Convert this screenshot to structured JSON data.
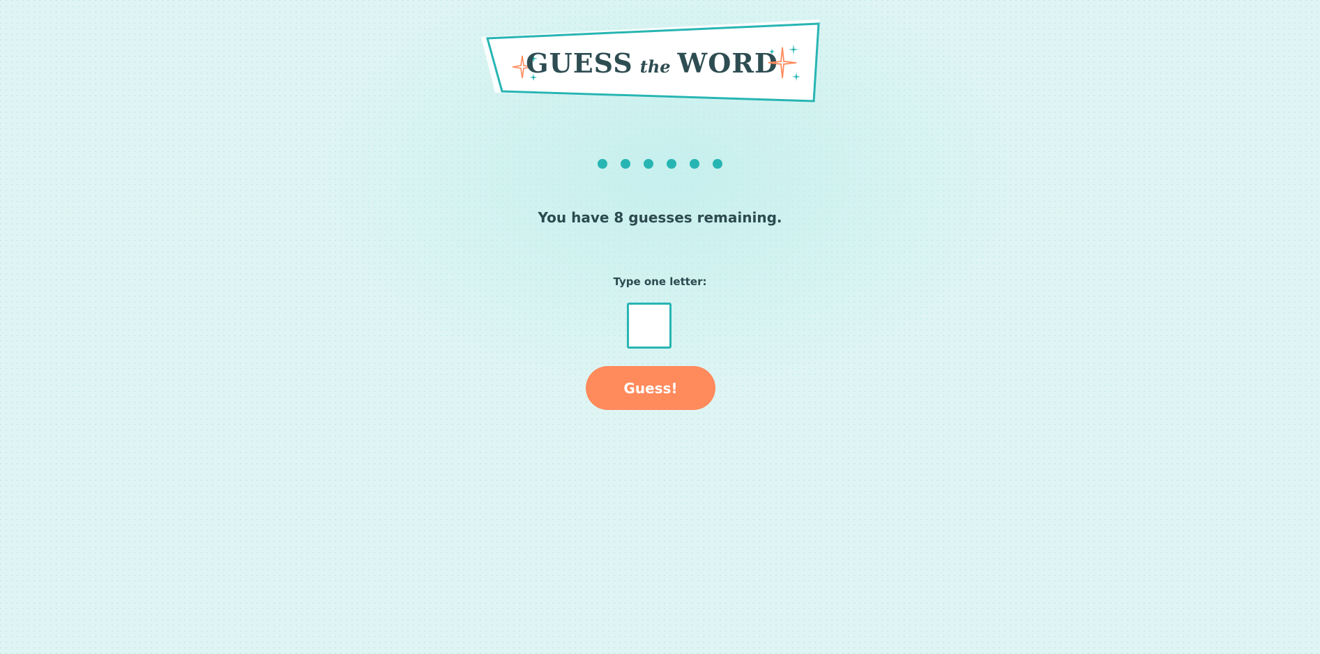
{
  "header": {
    "title_part1": "GUESS",
    "title_part2": "the",
    "title_part3": "WORD"
  },
  "word_progress": {
    "letters": [
      "●",
      "●",
      "●",
      "●",
      "●",
      "●"
    ]
  },
  "status": {
    "remaining_text": "You have 8 guesses remaining."
  },
  "guess_form": {
    "label": "Type one letter:",
    "input_value": "",
    "button_label": "Guess!"
  },
  "colors": {
    "accent_teal": "#27b5b3",
    "button_coral": "#ff8a5c",
    "text_dark": "#2c4a4f",
    "background": "#dff5f4"
  }
}
